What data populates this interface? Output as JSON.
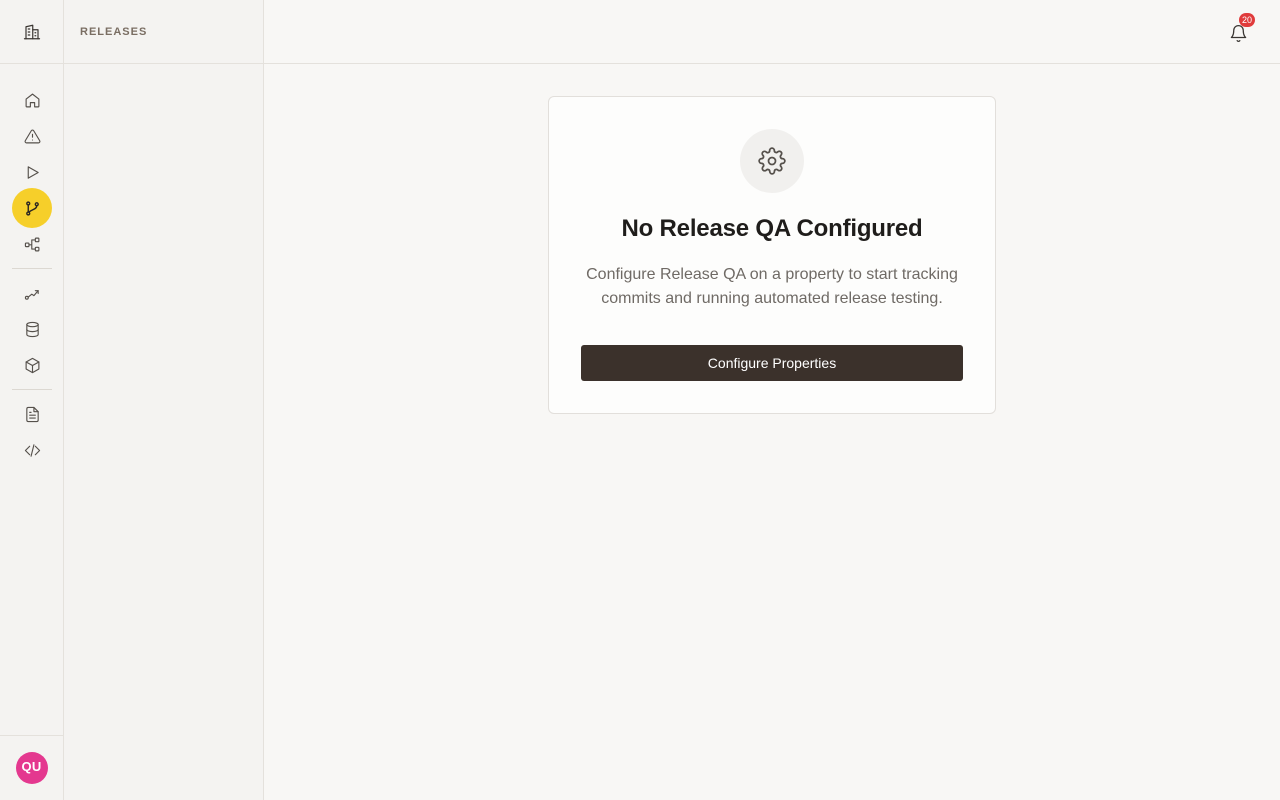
{
  "rail": {
    "logo_icon": "building-icon",
    "items": [
      {
        "icon": "home-icon"
      },
      {
        "icon": "alert-triangle-icon"
      },
      {
        "icon": "play-icon"
      },
      {
        "icon": "git-branch-icon",
        "active": true
      },
      {
        "icon": "workflow-icon"
      },
      {
        "icon": "route-icon"
      },
      {
        "icon": "database-icon"
      },
      {
        "icon": "package-icon"
      },
      {
        "icon": "file-text-icon"
      },
      {
        "icon": "code-icon"
      }
    ],
    "avatar_initials": "QU",
    "avatar_color": "#e4388f",
    "active_color": "#f6cf2a"
  },
  "subnav": {
    "title": "RELEASES"
  },
  "topbar": {
    "notification_count": "20",
    "notification_icon": "bell-icon"
  },
  "empty_state": {
    "icon": "gear-icon",
    "title": "No Release QA Configured",
    "description": "Configure Release QA on a property to start tracking commits and running automated release testing.",
    "button_label": "Configure Properties"
  }
}
